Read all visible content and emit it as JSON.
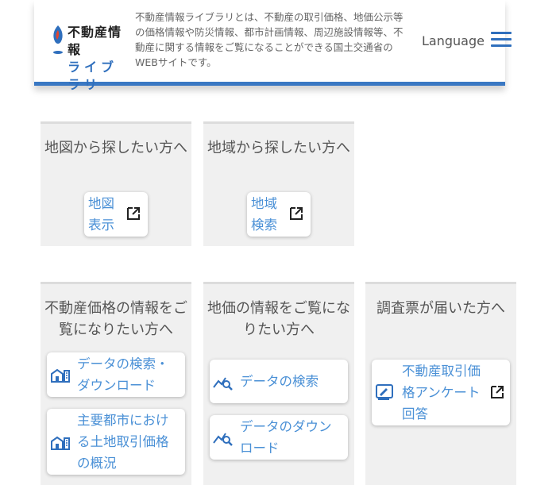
{
  "header": {
    "logo_line1": "不動産情報",
    "logo_line2": "ライブラリ",
    "description": "不動産情報ライブラリとは、不動産の取引価格、地価公示等の価格情報や防災情報、都市計画情報、周辺施設情報等、不動産に関する情報をご覧になることができる国土交通省のWEBサイトです。",
    "language_label": "Language"
  },
  "cards": {
    "map": {
      "title": "地図から探したい方へ",
      "button": "地図表示"
    },
    "area": {
      "title": "地域から探したい方へ",
      "button": "地域検索"
    },
    "price": {
      "title": "不動産価格の情報をご覧になりたい方へ",
      "button1": "データの検索・ダウンロード",
      "button2": "主要都市における土地取引価格の概況"
    },
    "landprice": {
      "title": "地価の情報をご覧になりたい方へ",
      "button1": "データの検索",
      "button2": "データのダウンロード"
    },
    "survey": {
      "title": "調査票が届いた方へ",
      "button": "不動産取引価格アンケート回答"
    }
  },
  "colors": {
    "accent": "#3a78c3",
    "link": "#4a90d6",
    "card_bg": "#f0f0f0"
  }
}
